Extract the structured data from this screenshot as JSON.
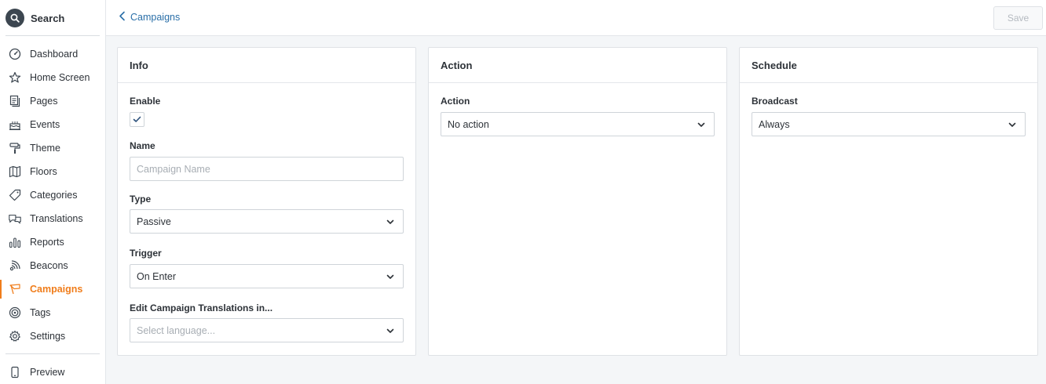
{
  "sidebar": {
    "search_label": "Search",
    "items": [
      {
        "label": "Dashboard",
        "icon": "gauge-icon"
      },
      {
        "label": "Home Screen",
        "icon": "star-icon"
      },
      {
        "label": "Pages",
        "icon": "pages-icon"
      },
      {
        "label": "Events",
        "icon": "cake-icon"
      },
      {
        "label": "Theme",
        "icon": "paint-roller-icon"
      },
      {
        "label": "Floors",
        "icon": "map-icon"
      },
      {
        "label": "Categories",
        "icon": "tag-icon"
      },
      {
        "label": "Translations",
        "icon": "translate-icon"
      },
      {
        "label": "Reports",
        "icon": "bar-chart-icon"
      },
      {
        "label": "Beacons",
        "icon": "beacon-icon"
      },
      {
        "label": "Campaigns",
        "icon": "megaphone-icon",
        "active": true
      },
      {
        "label": "Tags",
        "icon": "target-icon"
      },
      {
        "label": "Settings",
        "icon": "gear-icon"
      }
    ],
    "preview_label": "Preview"
  },
  "header": {
    "back_label": "Campaigns",
    "save_label": "Save"
  },
  "info": {
    "title": "Info",
    "enable_label": "Enable",
    "enable_checked": true,
    "name_label": "Name",
    "name_placeholder": "Campaign Name",
    "type_label": "Type",
    "type_value": "Passive",
    "trigger_label": "Trigger",
    "trigger_value": "On Enter",
    "translations_label": "Edit Campaign Translations in...",
    "translations_placeholder": "Select language..."
  },
  "action": {
    "title": "Action",
    "action_label": "Action",
    "action_value": "No action"
  },
  "schedule": {
    "title": "Schedule",
    "broadcast_label": "Broadcast",
    "broadcast_value": "Always"
  },
  "colors": {
    "accent": "#f07d1b",
    "link": "#2a6fa8",
    "search_circle": "#3c4650"
  }
}
